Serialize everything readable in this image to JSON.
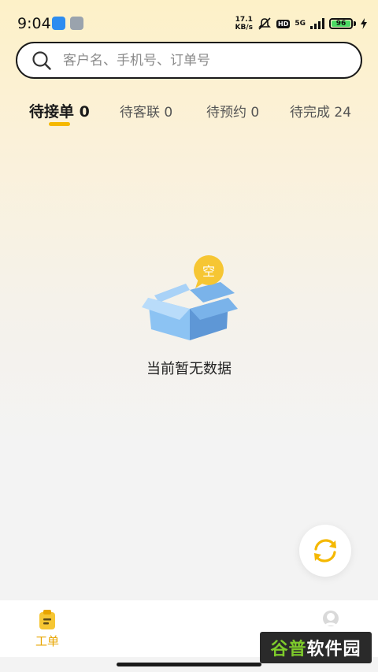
{
  "status_bar": {
    "time": "9:04",
    "net_speed_value": "17.1",
    "net_speed_unit": "KB/s",
    "hd": "HD",
    "network": "5G",
    "battery": "96"
  },
  "search": {
    "placeholder": "客户名、手机号、订单号",
    "value": ""
  },
  "tabs": [
    {
      "label": "待接单 0",
      "active": true
    },
    {
      "label": "待客联 0",
      "active": false
    },
    {
      "label": "待预约 0",
      "active": false
    },
    {
      "label": "待完成 24",
      "active": false
    }
  ],
  "empty_state": {
    "bubble_text": "空",
    "message": "当前暂无数据"
  },
  "bottom_nav": {
    "items": [
      {
        "label": "工单",
        "active": true
      },
      {
        "label": "",
        "active": false
      }
    ]
  },
  "watermark": {
    "part1": "谷普",
    "part2": "软件园"
  },
  "colors": {
    "accent": "#f5b800",
    "accent_text": "#e8a500",
    "box_blue": "#7fb6ec",
    "battery_green": "#4cd964"
  }
}
